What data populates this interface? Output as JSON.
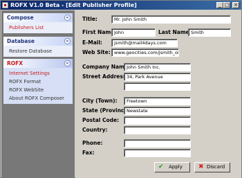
{
  "window": {
    "title": "ROFX V1.0 Beta - [Edit Publisher Profile]",
    "min": "_",
    "max": "□",
    "close": "×"
  },
  "sidebar": {
    "groups": [
      {
        "title": "Compose",
        "items": [
          "Publishers List"
        ]
      },
      {
        "title": "Database",
        "items": [
          "Restore Database"
        ]
      },
      {
        "title": "ROFX",
        "items": [
          "Internet Settings",
          "ROFX Format",
          "ROFX WebSite",
          "About ROFX Composer"
        ]
      }
    ],
    "collapse_glyph": "«"
  },
  "form": {
    "labels": {
      "title": "Title:",
      "first_name": "First Name:",
      "last_name": "Last Name:",
      "email": "E-Mail:",
      "website": "Web Site:",
      "company": "Company Name:",
      "street": "Street Address:",
      "city": "City (Town):",
      "state": "State (Province):",
      "postal": "Postal Code:",
      "country": "Country:",
      "phone": "Phone:",
      "fax": "Fax:"
    },
    "values": {
      "title": "Mr. John Smith",
      "first_name": "John",
      "last_name": "Smith",
      "email": "jsmith@mail4days.com",
      "website": "www.geocities.com/jsmith_older",
      "company": "John Smith Inc.",
      "street1": "34, Park Avenue",
      "street2": "",
      "city": "Freetown",
      "state": "Newstate",
      "postal": "",
      "country": "",
      "phone": "",
      "fax": ""
    },
    "buttons": {
      "apply": "Apply",
      "discard": "Discard"
    }
  },
  "icons": {
    "apply": "check-icon",
    "discard": "x-icon"
  },
  "colors": {
    "titlebar": "#0a246a",
    "active_item": "#c41c1c",
    "apply_icon": "#1e9a1e",
    "discard_icon": "#d42020"
  }
}
